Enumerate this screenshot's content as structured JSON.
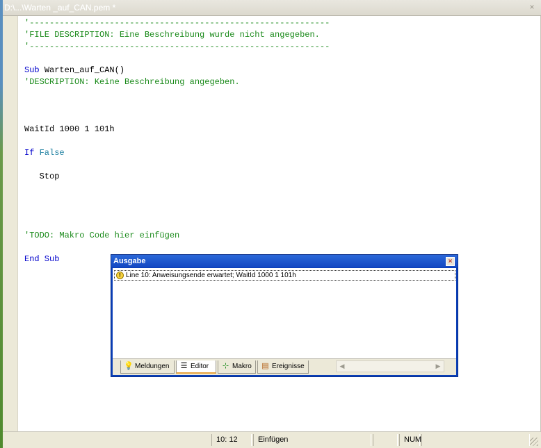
{
  "window": {
    "title": "D:\\...\\Warten _auf_CAN.pem *",
    "close": "×"
  },
  "code": {
    "lines": [
      {
        "text": "'------------------------------------------------------------",
        "cls": "cm"
      },
      {
        "text": "'FILE DESCRIPTION: Eine Beschreibung wurde nicht angegeben.",
        "cls": "cm"
      },
      {
        "text": "'------------------------------------------------------------",
        "cls": "cm"
      },
      {
        "text": "",
        "cls": "tx"
      },
      {
        "text": "",
        "cls": "tx",
        "parts": [
          {
            "t": "Sub ",
            "c": "kw"
          },
          {
            "t": "Warten_auf_CAN()",
            "c": "tx"
          }
        ]
      },
      {
        "text": "'DESCRIPTION: Keine Beschreibung angegeben.",
        "cls": "cm"
      },
      {
        "text": "",
        "cls": "tx"
      },
      {
        "text": "",
        "cls": "tx"
      },
      {
        "text": "",
        "cls": "tx"
      },
      {
        "text": "WaitId 1000 1 101h",
        "cls": "tx"
      },
      {
        "text": "",
        "cls": "tx"
      },
      {
        "text": "",
        "cls": "tx",
        "parts": [
          {
            "t": "If ",
            "c": "kw"
          },
          {
            "t": "False",
            "c": "kw2"
          }
        ]
      },
      {
        "text": "",
        "cls": "tx"
      },
      {
        "text": "   Stop",
        "cls": "tx"
      },
      {
        "text": "",
        "cls": "tx"
      },
      {
        "text": "",
        "cls": "tx"
      },
      {
        "text": "",
        "cls": "tx"
      },
      {
        "text": "",
        "cls": "tx"
      },
      {
        "text": "'TODO: Makro Code hier einfügen",
        "cls": "cm"
      },
      {
        "text": "",
        "cls": "tx"
      },
      {
        "text": "End Sub",
        "cls": "kw"
      }
    ]
  },
  "output_panel": {
    "title": "Ausgabe",
    "close": "×",
    "messages": [
      {
        "icon": "warning-icon",
        "text": "Line 10: Anweisungsende erwartet; WaitId 1000 1 101h"
      }
    ],
    "tabs": [
      {
        "label": "Meldungen",
        "icon": "lightbulb-icon",
        "glyph": "💡"
      },
      {
        "label": "Editor",
        "icon": "document-lines-icon",
        "glyph": "☰"
      },
      {
        "label": "Makro",
        "icon": "network-nodes-icon",
        "glyph": "⊹"
      },
      {
        "label": "Ereignisse",
        "icon": "event-list-icon",
        "glyph": "▤"
      }
    ],
    "active_tab": "Editor"
  },
  "statusbar": {
    "position": "10: 12",
    "mode": "Einfügen",
    "num": "NUM"
  },
  "colors": {
    "keyword": "#0000cc",
    "comment": "#1a8a1a",
    "panel_title": "#1a52cf"
  }
}
